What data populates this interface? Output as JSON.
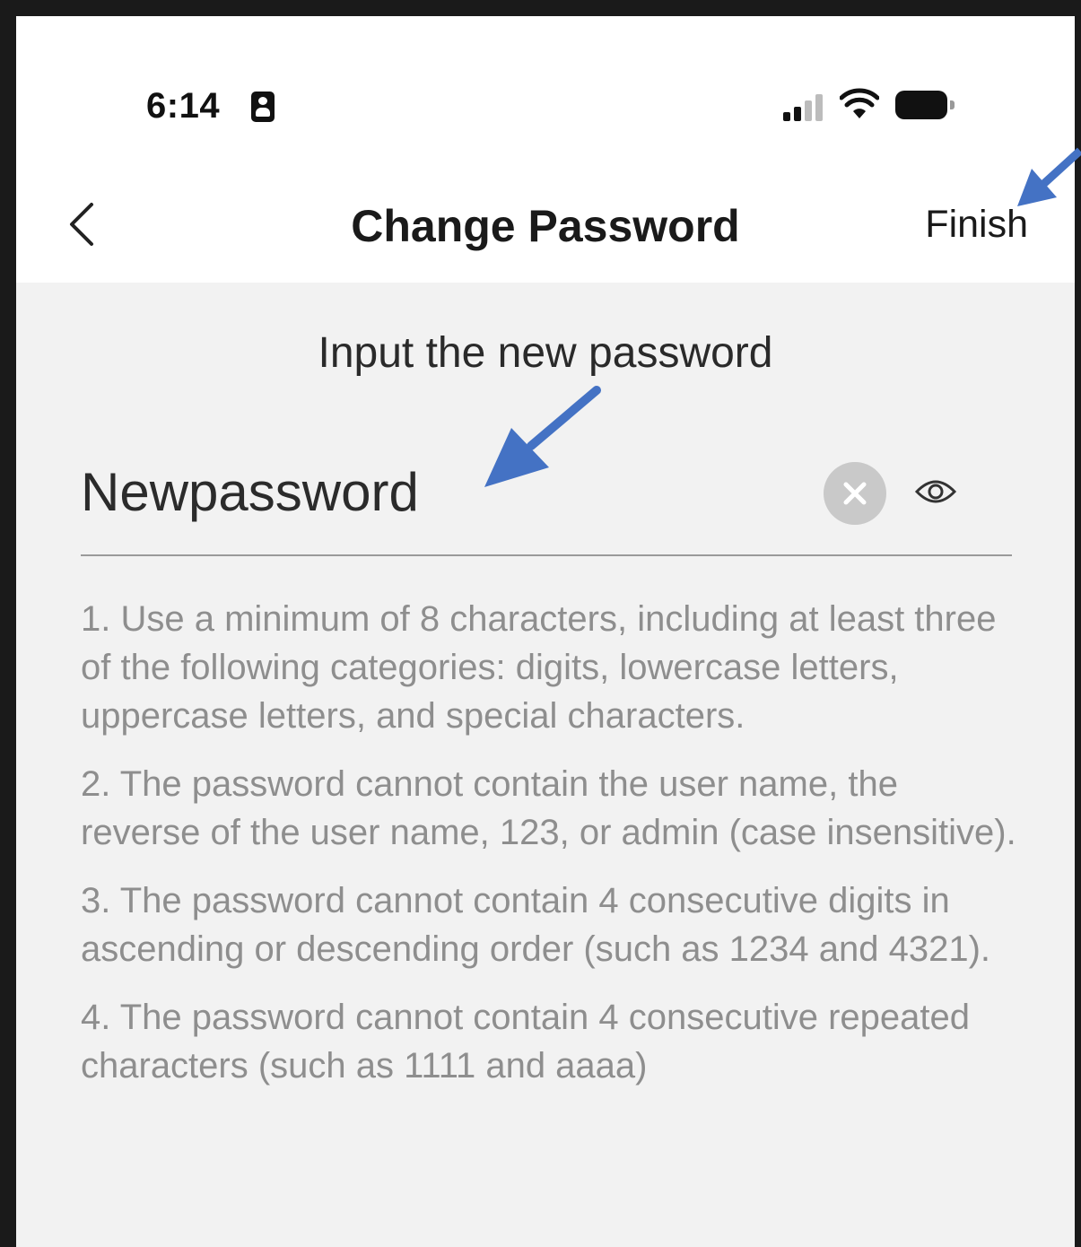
{
  "status_bar": {
    "time": "6:14"
  },
  "nav": {
    "title": "Change Password",
    "finish_label": "Finish"
  },
  "form": {
    "heading": "Input the new password",
    "password_value": "Newpassword"
  },
  "rules": [
    "1. Use a minimum of 8 characters, including at least three of the following categories: digits, lowercase letters, uppercase letters, and special characters.",
    "2. The password cannot contain the user name, the reverse of the user name, 123, or admin (case insensitive).",
    "3. The password cannot contain 4 consecutive digits in ascending or descending order (such as 1234 and 4321).",
    "4. The password cannot contain 4 consecutive repeated characters (such as 1111 and aaaa)"
  ],
  "colors": {
    "annotation_arrow": "#4472c4",
    "background": "#f2f2f2",
    "header": "#ffffff",
    "hint_text": "#8e8e8e"
  },
  "icons": {
    "back": "chevron-left-icon",
    "clear": "clear-icon",
    "visibility": "eye-icon",
    "signal": "signal-icon",
    "wifi": "wifi-icon",
    "battery": "battery-icon",
    "focus": "focus-mode-icon"
  }
}
